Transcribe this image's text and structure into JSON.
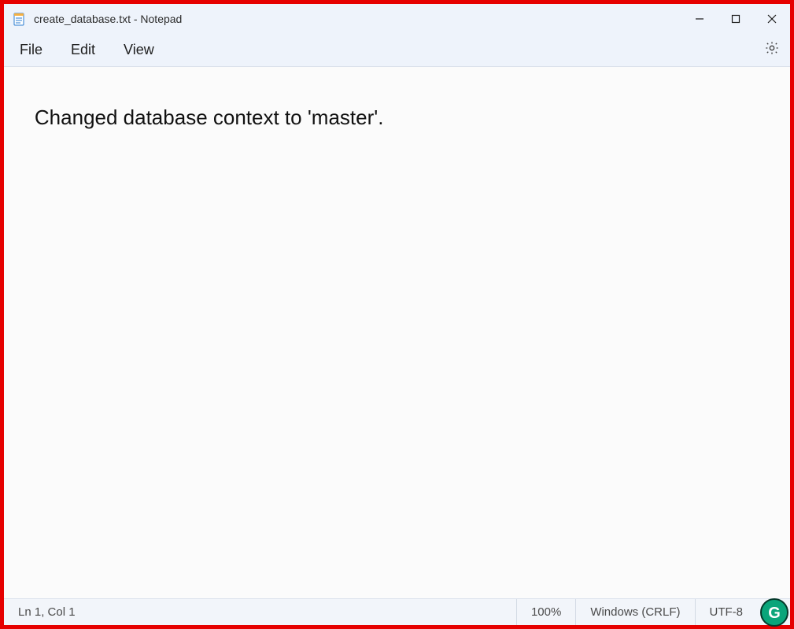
{
  "window": {
    "title": "create_database.txt - Notepad"
  },
  "menu": {
    "file": "File",
    "edit": "Edit",
    "view": "View"
  },
  "editor": {
    "content": "Changed database context to 'master'."
  },
  "status": {
    "position": "Ln 1, Col 1",
    "zoom": "100%",
    "line_ending": "Windows (CRLF)",
    "encoding": "UTF-8"
  },
  "grammarly": {
    "letter": "G"
  }
}
